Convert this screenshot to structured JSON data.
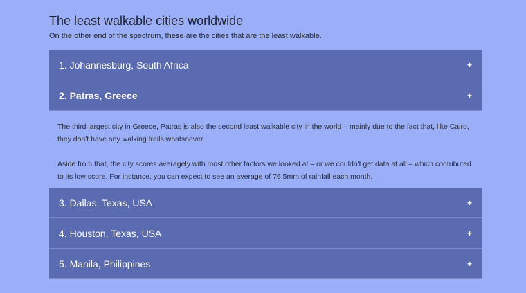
{
  "page": {
    "title": "The least walkable cities worldwide",
    "subtitle": "On the other end of the spectrum, these are the cities that are the least walkable."
  },
  "accordion": {
    "items": [
      {
        "label": "1. Johannesburg, South Africa",
        "icon": "+",
        "expanded": false
      },
      {
        "label": "2. Patras, Greece",
        "icon": "+",
        "expanded": true,
        "paragraphs": [
          "The third largest city in Greece, Patras is also the second least walkable city in the world – mainly due to the fact that, like Cairo, they don't have any walking trails whatsoever.",
          "Aside from that, the city scores averagely with most other factors we looked at – or we couldn't get data at all – which contributed to its low score. For instance, you can expect to see an average of 76.5mm of rainfall each month."
        ]
      },
      {
        "label": "3. Dallas, Texas, USA",
        "icon": "+",
        "expanded": false
      },
      {
        "label": "4. Houston, Texas, USA",
        "icon": "+",
        "expanded": false
      },
      {
        "label": "5. Manila, Philippines",
        "icon": "+",
        "expanded": false
      }
    ]
  },
  "colors": {
    "background": "#9aaff7",
    "header": "#5a6bb1",
    "header_text": "#ffffff"
  }
}
